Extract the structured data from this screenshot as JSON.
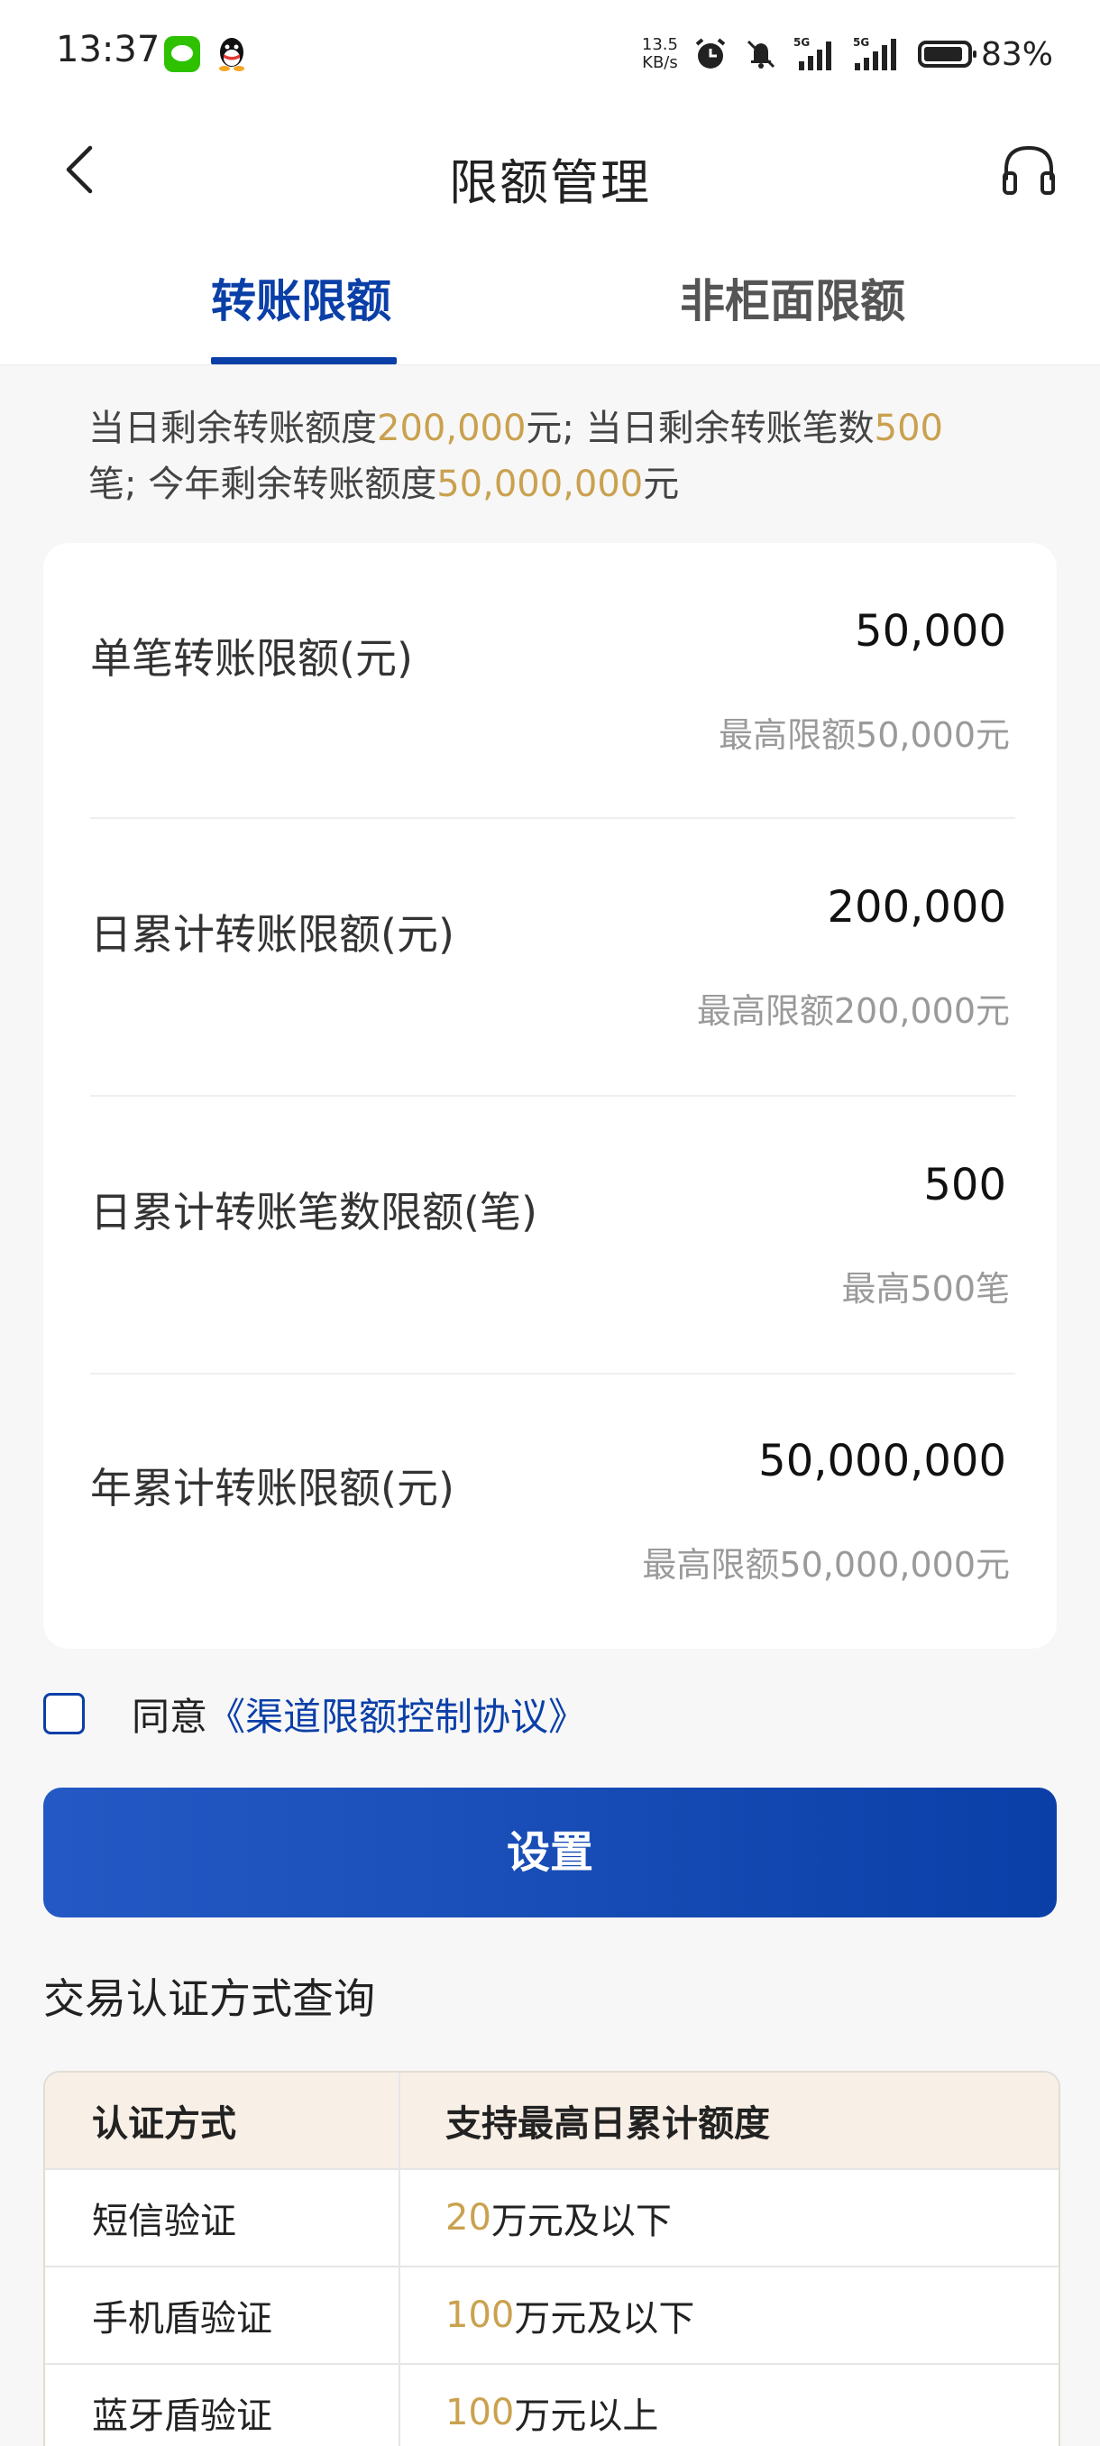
{
  "status_bar": {
    "time": "13:37",
    "net_speed_value": "13.5",
    "net_speed_unit": "KB/s",
    "signal_1": "5G",
    "signal_2": "5G",
    "battery": "83%"
  },
  "navbar": {
    "title": "限额管理"
  },
  "tabs": [
    {
      "label": "转账限额",
      "active": true
    },
    {
      "label": "非柜面限额",
      "active": false
    }
  ],
  "summary": {
    "p1": "当日剩余转账额度",
    "v1": "200,000",
    "p2": "元; 当日剩余转账笔数",
    "v2": "500",
    "p3": "笔; 今年剩余转账额度",
    "v3": "50,000,000",
    "p4": "元"
  },
  "limits": [
    {
      "label": "单笔转账限额(元)",
      "value": "50,000",
      "max": "最高限额50,000元"
    },
    {
      "label": "日累计转账限额(元)",
      "value": "200,000",
      "max": "最高限额200,000元"
    },
    {
      "label": "日累计转账笔数限额(笔)",
      "value": "500",
      "max": "最高500笔"
    },
    {
      "label": "年累计转账限额(元)",
      "value": "50,000,000",
      "max": "最高限额50,000,000元"
    }
  ],
  "agreement": {
    "prefix": "同意",
    "link": "《渠道限额控制协议》",
    "checked": false
  },
  "set_button": "设置",
  "auth_section": {
    "title": "交易认证方式查询",
    "headers": [
      "认证方式",
      "支持最高日累计额度"
    ],
    "rows": [
      {
        "method": "短信验证",
        "amount": "20",
        "suffix": "万元及以下"
      },
      {
        "method": "手机盾验证",
        "amount": "100",
        "suffix": "万元及以下"
      },
      {
        "method": "蓝牙盾验证",
        "amount": "100",
        "suffix": "万元以上"
      }
    ]
  },
  "colors": {
    "primary": "#0b3fa8",
    "gold": "#caa14f",
    "table_header": "#f8efe6"
  }
}
